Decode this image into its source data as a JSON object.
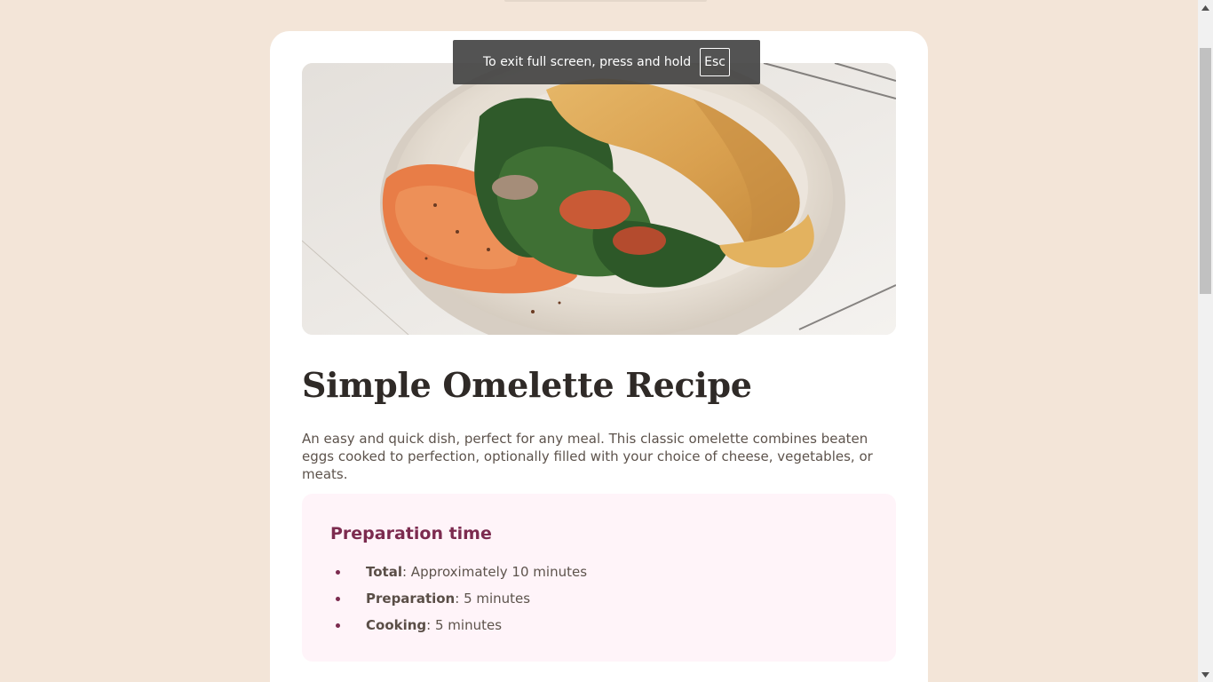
{
  "recipe": {
    "hero_image_alt": "omelette-plate-photo",
    "title": "Simple Omelette Recipe",
    "description": "An easy and quick dish, perfect for any meal. This classic omelette combines beaten eggs cooked to perfection, optionally filled with your choice of cheese, vegetables, or meats."
  },
  "preparation": {
    "heading": "Preparation time",
    "items": [
      {
        "label": "Total",
        "value": ": Approximately 10 minutes"
      },
      {
        "label": "Preparation",
        "value": ": 5 minutes"
      },
      {
        "label": "Cooking",
        "value": ": 5 minutes"
      }
    ]
  },
  "fullscreen_toast": {
    "message": "To exit full screen, press and hold",
    "key": "Esc"
  },
  "colors": {
    "page_background": "#f3e5d8",
    "card_background": "#ffffff",
    "heading_dark": "#2f2a27",
    "accent_plum": "#7c2b4f",
    "prep_background": "#fff4f9",
    "body_text": "#5d534c"
  },
  "icons": {
    "scroll_up": "triangle-up-icon",
    "scroll_down": "triangle-down-icon",
    "bullet": "disc-bullet-icon"
  }
}
